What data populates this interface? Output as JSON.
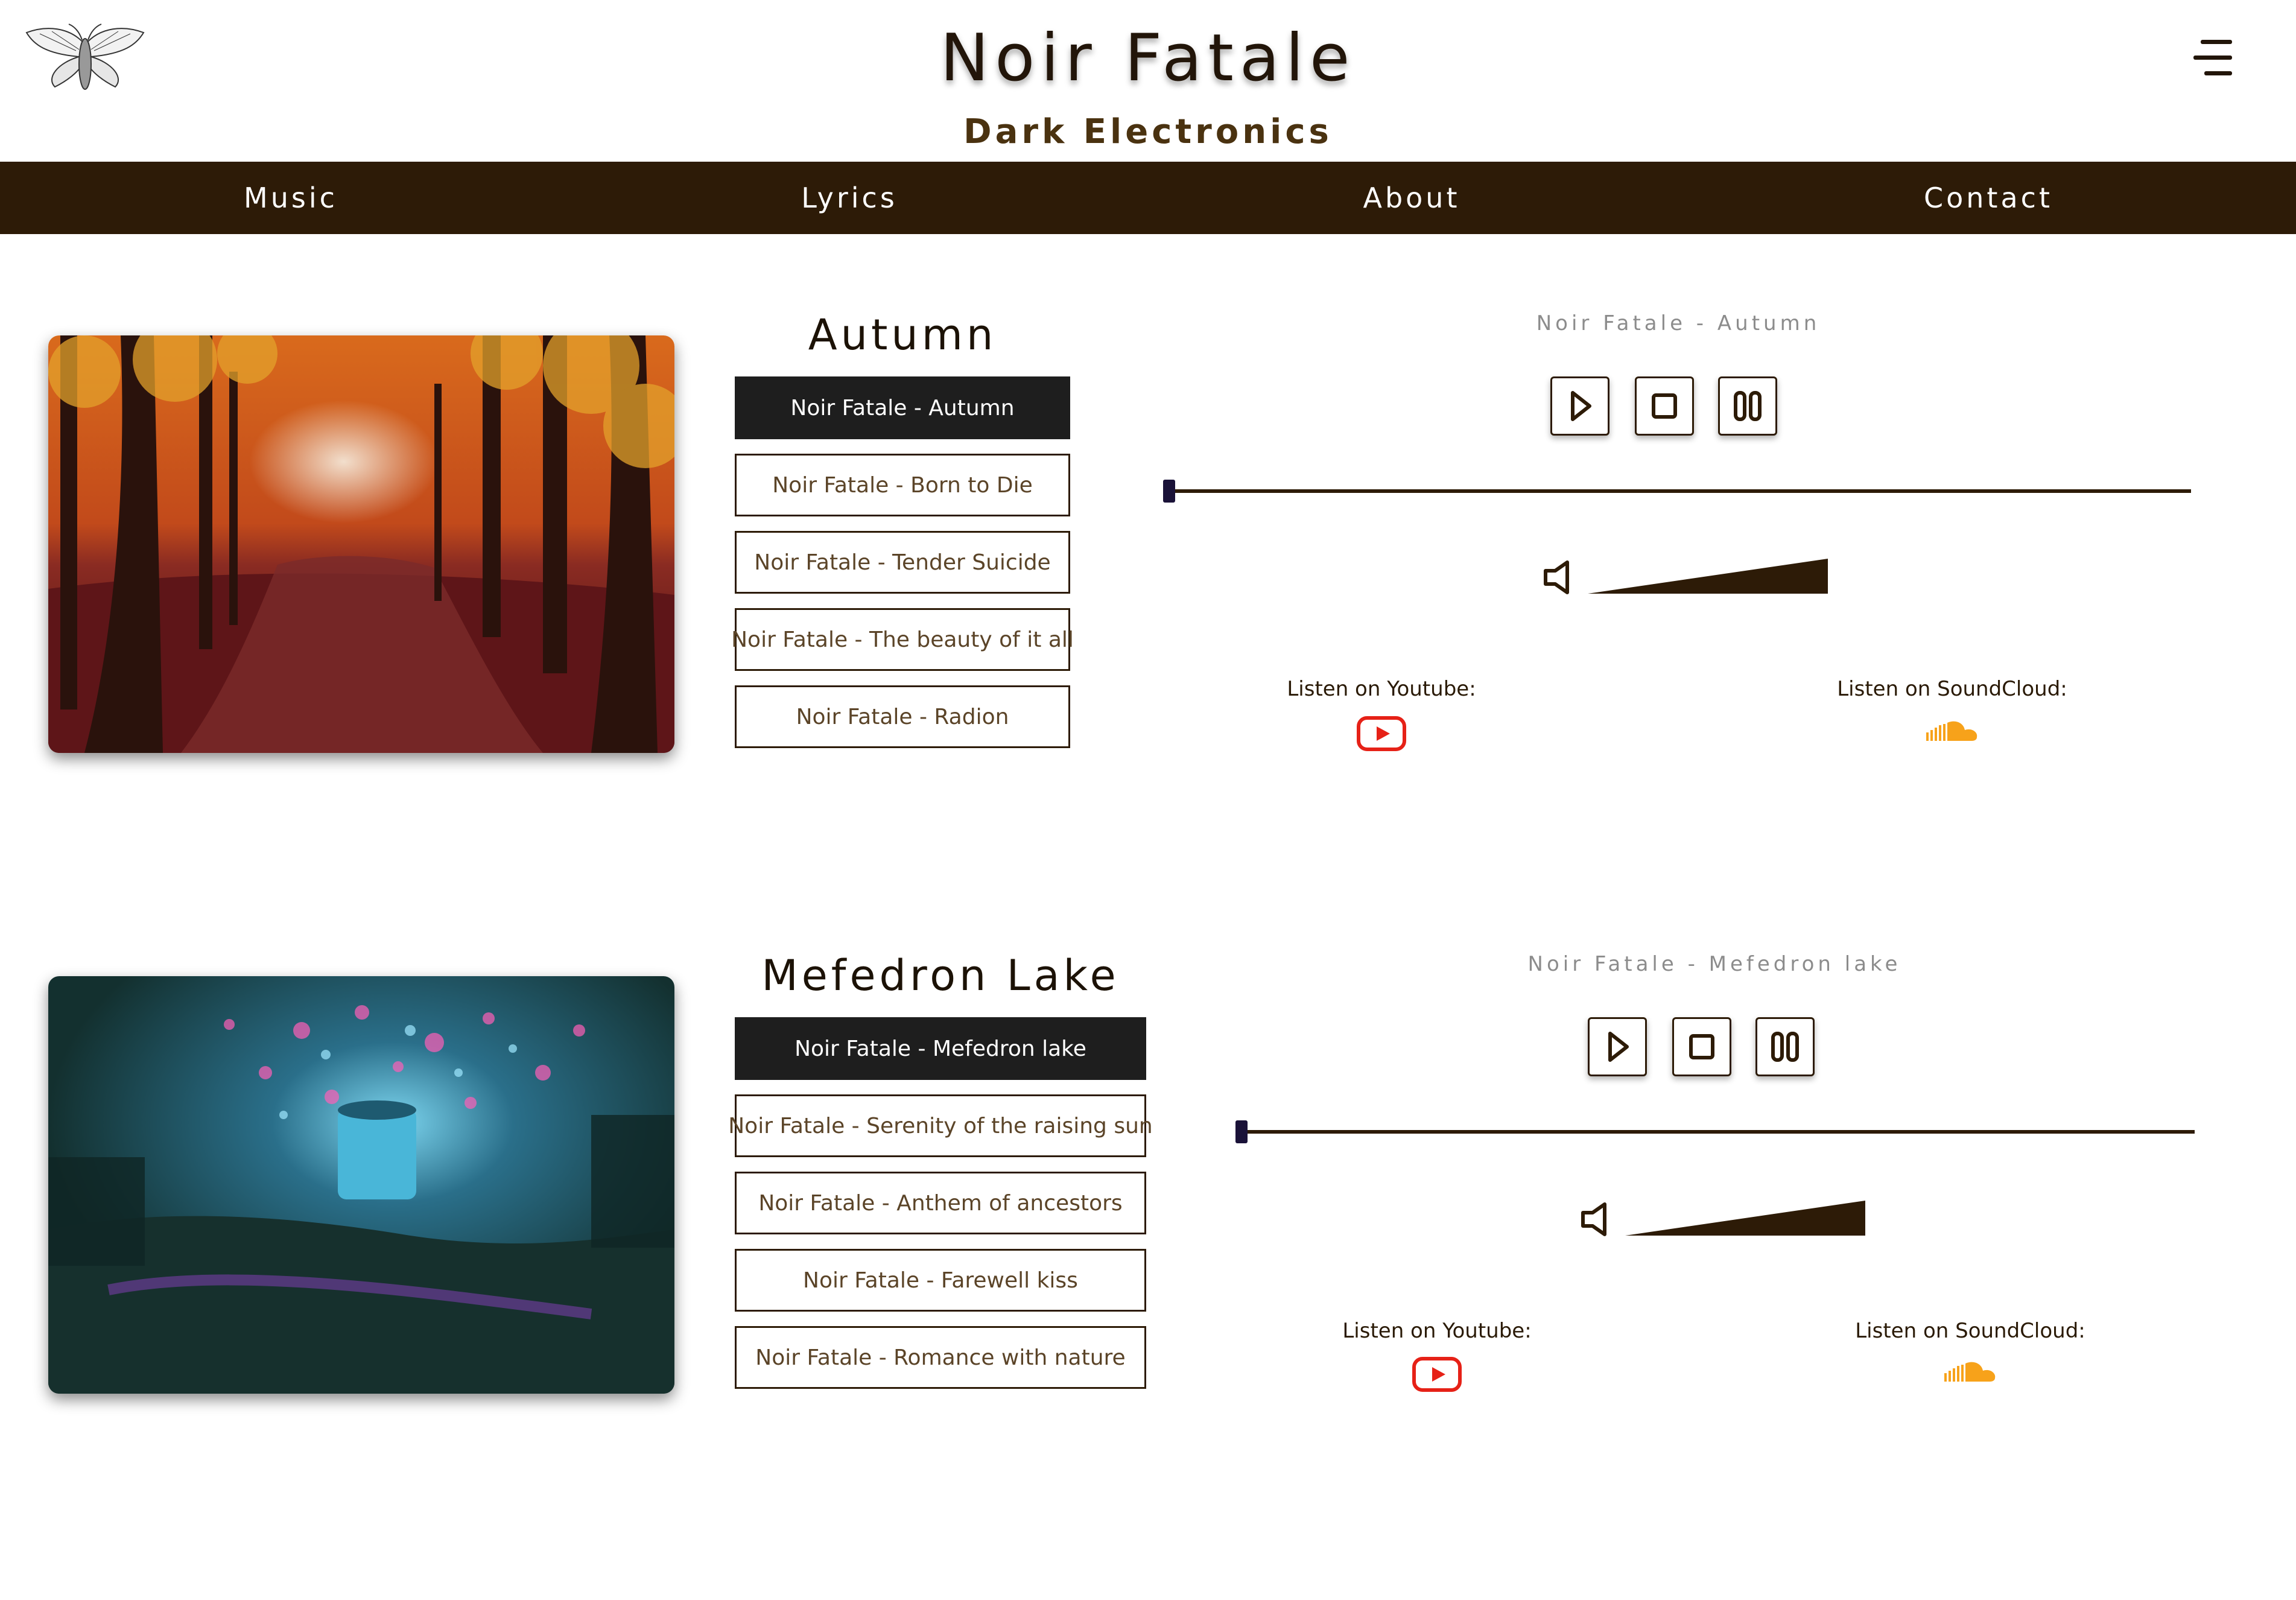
{
  "header": {
    "title": "Noir Fatale",
    "subtitle": "Dark Electronics",
    "logo_icon": "moth-icon",
    "menu_icon": "hamburger-icon"
  },
  "nav": {
    "items": [
      {
        "label": "Music"
      },
      {
        "label": "Lyrics"
      },
      {
        "label": "About"
      },
      {
        "label": "Contact"
      }
    ]
  },
  "colors": {
    "brand_brown": "#2d1b07",
    "active_track": "#1e1e1e",
    "youtube_red": "#e62117",
    "soundcloud_orange": "#f7a21a"
  },
  "albums": [
    {
      "title": "Autumn",
      "tracks": [
        {
          "label": "Noir Fatale - Autumn",
          "active": true
        },
        {
          "label": "Noir Fatale - Born to Die",
          "active": false
        },
        {
          "label": "Noir Fatale - Tender Suicide",
          "active": false
        },
        {
          "label": "Noir Fatale - The beauty of it all",
          "active": false
        },
        {
          "label": "Noir Fatale - Radion",
          "active": false
        }
      ],
      "player": {
        "now_playing": "Noir Fatale - Autumn",
        "progress": 0,
        "volume": 1,
        "controls": [
          "play-icon",
          "stop-icon",
          "pause-icon"
        ]
      },
      "links": {
        "youtube_label": "Listen on Youtube:",
        "soundcloud_label": "Listen on SoundCloud:"
      }
    },
    {
      "title": "Mefedron Lake",
      "tracks": [
        {
          "label": "Noir Fatale - Mefedron lake",
          "active": true
        },
        {
          "label": "Noir Fatale - Serenity of the raising sun",
          "active": false
        },
        {
          "label": "Noir Fatale - Anthem of ancestors",
          "active": false
        },
        {
          "label": "Noir Fatale - Farewell kiss",
          "active": false
        },
        {
          "label": "Noir Fatale - Romance with nature",
          "active": false
        }
      ],
      "player": {
        "now_playing": "Noir Fatale - Mefedron lake",
        "progress": 0,
        "volume": 1,
        "controls": [
          "play-icon",
          "stop-icon",
          "pause-icon"
        ]
      },
      "links": {
        "youtube_label": "Listen on Youtube:",
        "soundcloud_label": "Listen on SoundCloud:"
      }
    }
  ]
}
